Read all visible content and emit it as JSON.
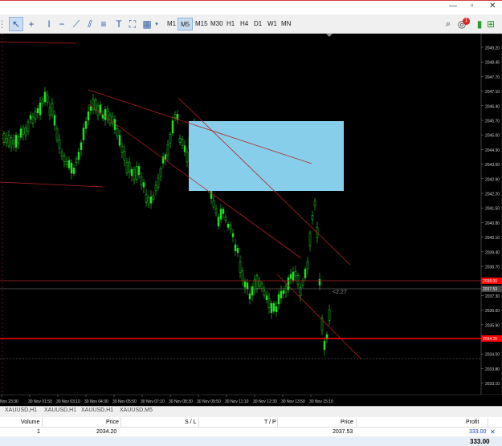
{
  "toolbar": {
    "timeframes": [
      "M1",
      "M5",
      "M15",
      "M30",
      "H1",
      "H4",
      "D1",
      "W1",
      "MN"
    ],
    "active_timeframe": "M5",
    "notification_count": "1"
  },
  "chart": {
    "price_labels": [
      "2049.20",
      "2048.45",
      "2047.70",
      "2047.10",
      "2046.40",
      "2045.70",
      "2045.00",
      "2044.30",
      "2043.60",
      "2042.90",
      "2042.20",
      "2041.50",
      "2040.80",
      "2040.10",
      "2039.40",
      "2038.70",
      "2038.00",
      "2037.30",
      "2036.60",
      "2035.90",
      "2035.20",
      "2034.50",
      "2033.80",
      "2033.10"
    ],
    "time_labels": [
      "Nov 23:30",
      "30 Nov 01:50",
      "30 Nov 03:10",
      "30 Nov 04:30",
      "30 Nov 05:50",
      "30 Nov 07:10",
      "30 Nov 08:30",
      "30 Nov 09:50",
      "30 Nov 11:10",
      "30 Nov 12:30",
      "30 Nov 13:50",
      "30 Nov 15:10"
    ],
    "countdown": "<2:27",
    "bid_marker": "2037.53",
    "red_marker": "2038.00",
    "entry_marker": "2034.20"
  },
  "tabs": [
    "XAUUSD,H1",
    "XAUUSD,H1",
    "XAUUSD,H1",
    "XAUUSD,M5"
  ],
  "table": {
    "headers": {
      "volume": "Volume",
      "price": "Price",
      "sl": "S / L",
      "tp": "T / P",
      "price2": "Price",
      "profit": "Profit"
    },
    "row": {
      "volume": "1",
      "price": "2034.20",
      "price2": "2037.53",
      "profit": "333.00"
    },
    "total": "333.00"
  },
  "colors": {
    "candle": "#22dd22",
    "box": "#87ceeb",
    "level": "#ff0000",
    "trend": "#b22222"
  }
}
